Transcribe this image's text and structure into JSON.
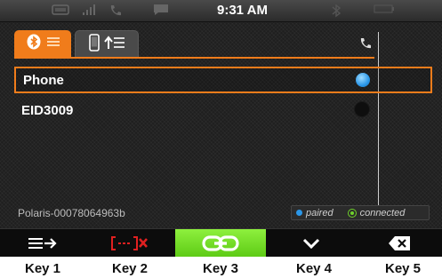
{
  "status_bar": {
    "time": "9:31 AM"
  },
  "tabs": [
    {
      "name": "bluetooth-devices",
      "icon": "bluetooth-list-icon",
      "active": true
    },
    {
      "name": "phone-transfer",
      "icon": "phone-upload-icon",
      "active": false
    }
  ],
  "devices": [
    {
      "label": "Phone",
      "state": "paired",
      "selected": true
    },
    {
      "label": "EID3009",
      "state": "none",
      "selected": false
    }
  ],
  "device_name": "Polaris-00078064963b",
  "legend": {
    "paired": "paired",
    "connected": "connected"
  },
  "keys": [
    {
      "caption": "Key 1",
      "icon": "menu-arrow-icon"
    },
    {
      "caption": "Key 2",
      "icon": "disconnect-icon"
    },
    {
      "caption": "Key 3",
      "icon": "link-icon"
    },
    {
      "caption": "Key 4",
      "icon": "chevron-down-icon"
    },
    {
      "caption": "Key 5",
      "icon": "backspace-icon"
    }
  ],
  "colors": {
    "accent": "#f07c1b",
    "paired": "#2b97e8",
    "connected": "#6fd22a",
    "active_key": "#6fd22a",
    "key2_icon": "#e02020"
  }
}
